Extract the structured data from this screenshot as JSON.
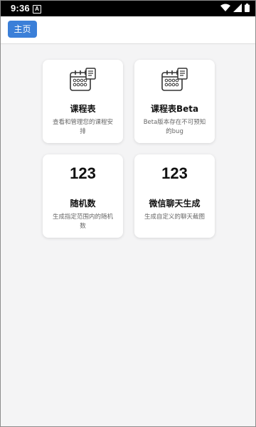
{
  "status_bar": {
    "time": "9:36",
    "notification_letter": "A"
  },
  "header": {
    "home_label": "主页"
  },
  "cards": [
    {
      "icon": "calendar-schedule-icon",
      "title": "课程表",
      "desc": "查看和管理您的课程安排"
    },
    {
      "icon": "calendar-schedule-icon",
      "title": "课程表Beta",
      "desc": "Beta版本存在不可预知的bug"
    },
    {
      "number": "123",
      "title": "随机数",
      "desc": "生成指定范围内的随机数"
    },
    {
      "number": "123",
      "title": "微信聊天生成",
      "desc": "生成自定义的聊天截图"
    }
  ]
}
